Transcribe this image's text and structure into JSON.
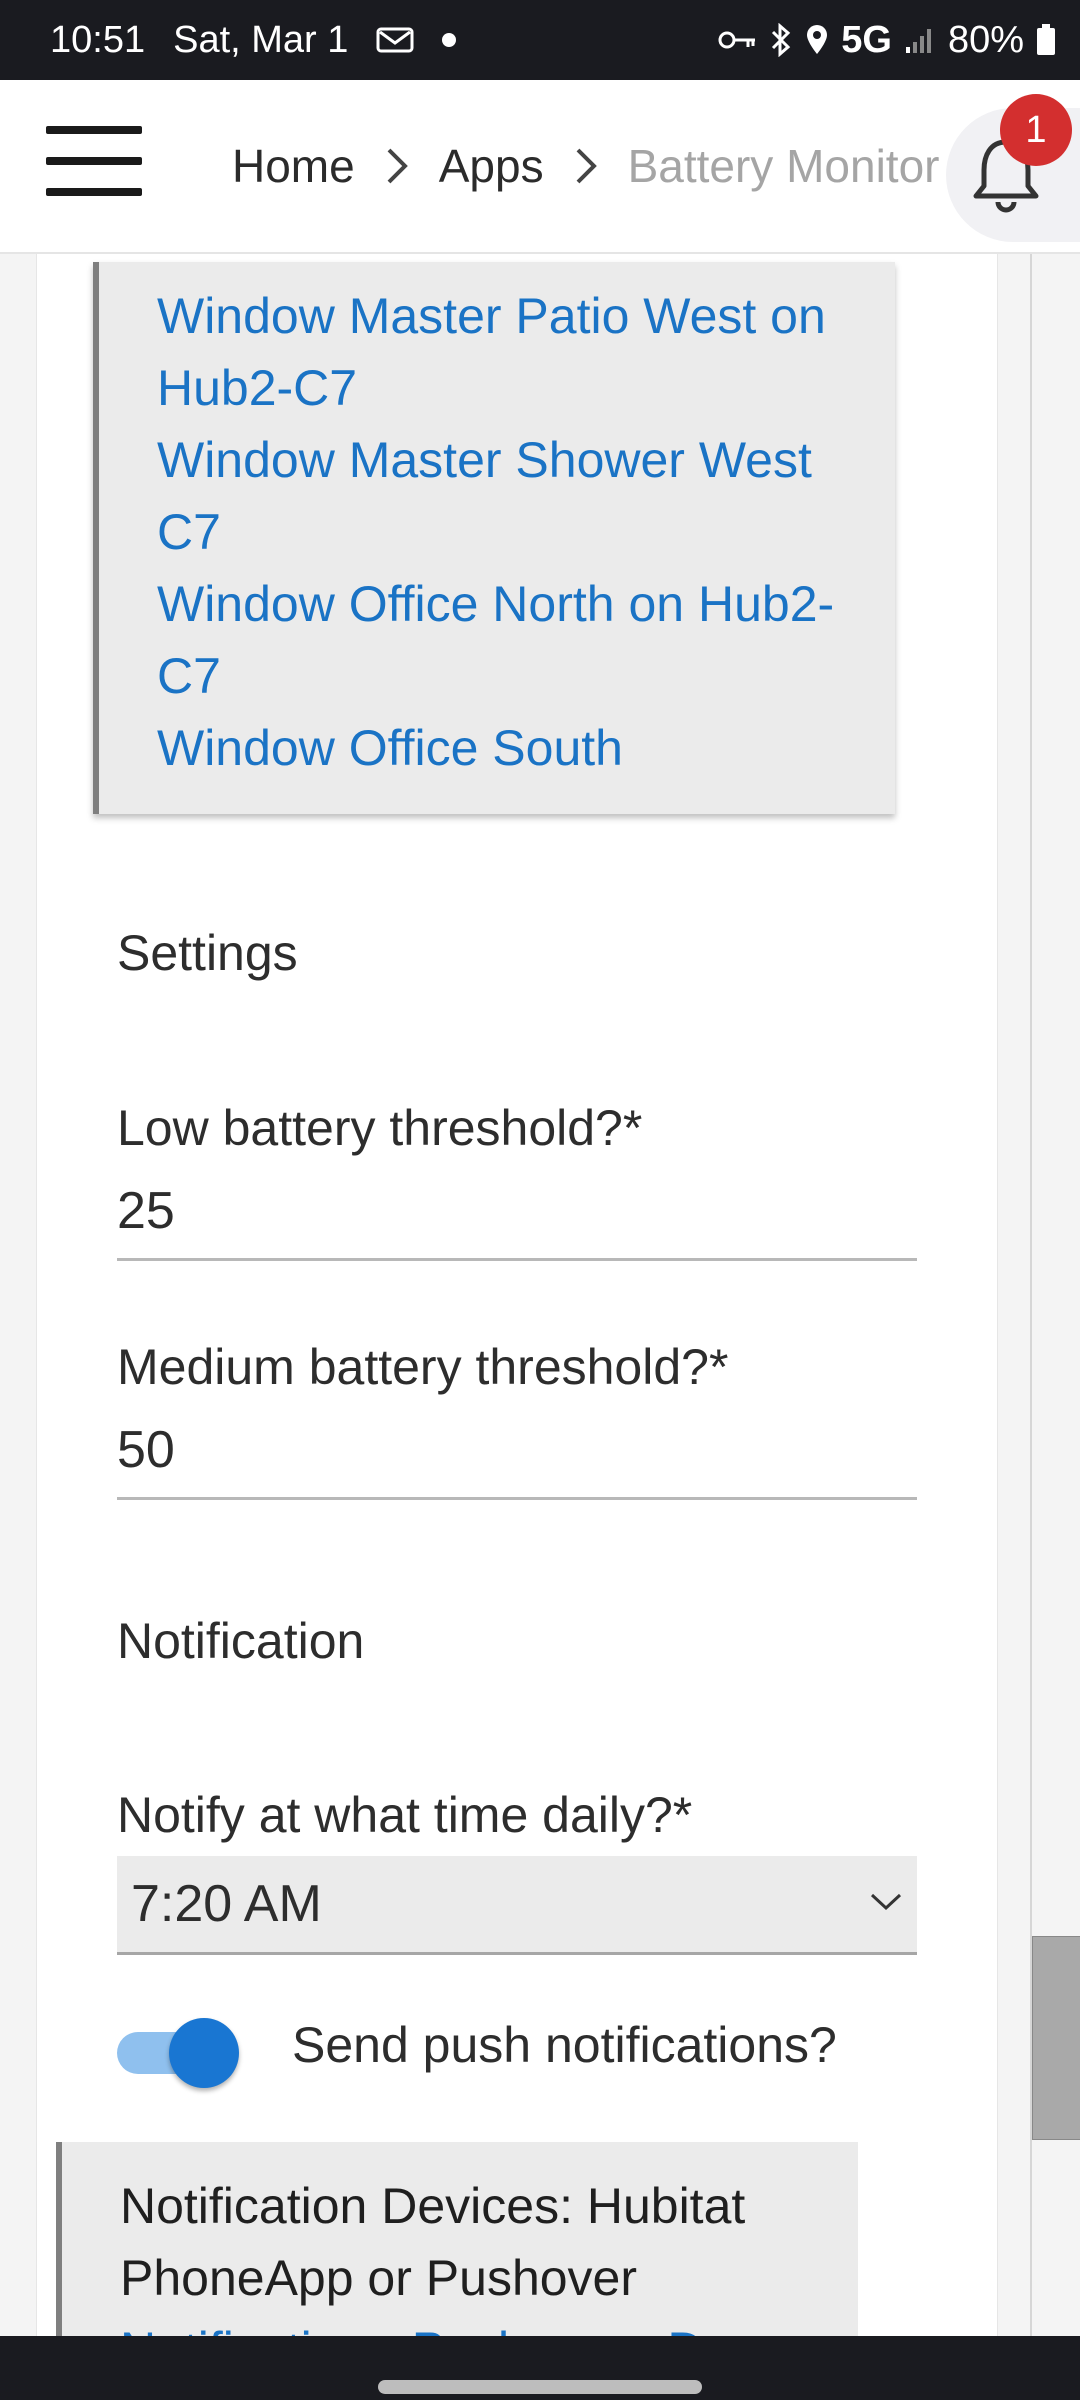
{
  "status_bar": {
    "time": "10:51",
    "date": "Sat, Mar 1",
    "network": "5G",
    "battery": "80%",
    "icons": [
      "mail-icon",
      "vpn-key-icon",
      "bluetooth-icon",
      "location-icon",
      "signal-icon",
      "battery-icon"
    ]
  },
  "header": {
    "breadcrumb": [
      "Home",
      "Apps",
      "Battery Monitor"
    ],
    "notification_count": "1"
  },
  "devices": [
    "Window Master Patio West on Hub2-C7",
    "Window Master Shower West C7",
    "Window Office North on Hub2-C7",
    "Window Office South"
  ],
  "settings": {
    "section_title": "Settings",
    "low_label": "Low battery threshold?*",
    "low_value": "25",
    "medium_label": "Medium battery threshold?*",
    "medium_value": "50"
  },
  "notification": {
    "section_title": "Notification",
    "time_label": "Notify at what time daily?*",
    "time_value": "7:20 AM",
    "push_label": "Send push notifications?",
    "push_enabled": true,
    "devices_label": "Notification Devices: Hubitat PhoneApp or Pushover",
    "devices_value_partial": "Notification - Pushover - D"
  },
  "colors": {
    "link": "#1a73c5",
    "accent": "#1976d2",
    "badge": "#d32f2f"
  }
}
